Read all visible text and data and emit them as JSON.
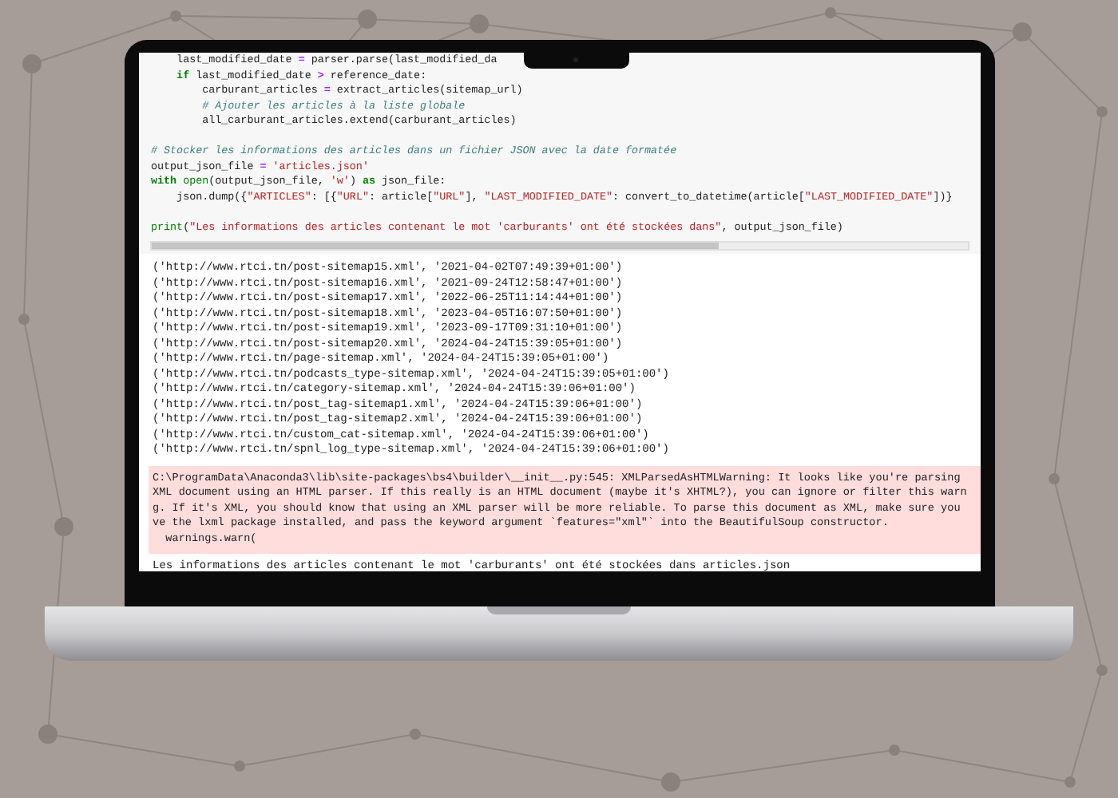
{
  "code_blocks": [
    [
      [
        {
          "kind": "plain",
          "text": "    last_modified_date "
        },
        {
          "kind": "operator",
          "text": "="
        },
        {
          "kind": "plain",
          "text": " parser.parse(last_modified_da"
        }
      ],
      [
        {
          "kind": "keyword",
          "text": "    if"
        },
        {
          "kind": "plain",
          "text": " last_modified_date "
        },
        {
          "kind": "operator",
          "text": ">"
        },
        {
          "kind": "plain",
          "text": " reference_date:"
        }
      ],
      [
        {
          "kind": "plain",
          "text": "        carburant_articles "
        },
        {
          "kind": "operator",
          "text": "="
        },
        {
          "kind": "plain",
          "text": " extract_articles(sitemap_url)"
        }
      ],
      [
        {
          "kind": "comment",
          "text": "        # Ajouter les articles à la liste globale"
        }
      ],
      [
        {
          "kind": "plain",
          "text": "        all_carburant_articles.extend(carburant_articles)"
        }
      ]
    ],
    [
      [
        {
          "kind": "comment",
          "text": "# Stocker les informations des articles dans un fichier JSON avec la date formatée"
        }
      ],
      [
        {
          "kind": "plain",
          "text": "output_json_file "
        },
        {
          "kind": "operator",
          "text": "="
        },
        {
          "kind": "string",
          "text": " 'articles.json'"
        }
      ],
      [
        {
          "kind": "keyword",
          "text": "with"
        },
        {
          "kind": "builtin",
          "text": " open"
        },
        {
          "kind": "plain",
          "text": "(output_json_file, "
        },
        {
          "kind": "string",
          "text": "'w'"
        },
        {
          "kind": "plain",
          "text": ") "
        },
        {
          "kind": "keyword",
          "text": "as"
        },
        {
          "kind": "plain",
          "text": " json_file:"
        }
      ],
      [
        {
          "kind": "plain",
          "text": "    json.dump({"
        },
        {
          "kind": "string",
          "text": "\"ARTICLES\""
        },
        {
          "kind": "plain",
          "text": ": [{"
        },
        {
          "kind": "string",
          "text": "\"URL\""
        },
        {
          "kind": "plain",
          "text": ": article["
        },
        {
          "kind": "string",
          "text": "\"URL\""
        },
        {
          "kind": "plain",
          "text": "], "
        },
        {
          "kind": "string",
          "text": "\"LAST_MODIFIED_DATE\""
        },
        {
          "kind": "plain",
          "text": ": convert_to_datetime(article["
        },
        {
          "kind": "string",
          "text": "\"LAST_MODIFIED_DATE\""
        },
        {
          "kind": "plain",
          "text": "])}"
        }
      ]
    ],
    [
      [
        {
          "kind": "builtin",
          "text": "print"
        },
        {
          "kind": "plain",
          "text": "("
        },
        {
          "kind": "string",
          "text": "\"Les informations des articles contenant le mot 'carburants' ont été stockées dans\""
        },
        {
          "kind": "plain",
          "text": ", output_json_file)"
        }
      ]
    ]
  ],
  "output_lines": [
    "('http://www.rtci.tn/post-sitemap15.xml', '2021-04-02T07:49:39+01:00')",
    "('http://www.rtci.tn/post-sitemap16.xml', '2021-09-24T12:58:47+01:00')",
    "('http://www.rtci.tn/post-sitemap17.xml', '2022-06-25T11:14:44+01:00')",
    "('http://www.rtci.tn/post-sitemap18.xml', '2023-04-05T16:07:50+01:00')",
    "('http://www.rtci.tn/post-sitemap19.xml', '2023-09-17T09:31:10+01:00')",
    "('http://www.rtci.tn/post-sitemap20.xml', '2024-04-24T15:39:05+01:00')",
    "('http://www.rtci.tn/page-sitemap.xml', '2024-04-24T15:39:05+01:00')",
    "('http://www.rtci.tn/podcasts_type-sitemap.xml', '2024-04-24T15:39:05+01:00')",
    "('http://www.rtci.tn/category-sitemap.xml', '2024-04-24T15:39:06+01:00')",
    "('http://www.rtci.tn/post_tag-sitemap1.xml', '2024-04-24T15:39:06+01:00')",
    "('http://www.rtci.tn/post_tag-sitemap2.xml', '2024-04-24T15:39:06+01:00')",
    "('http://www.rtci.tn/custom_cat-sitemap.xml', '2024-04-24T15:39:06+01:00')",
    "('http://www.rtci.tn/spnl_log_type-sitemap.xml', '2024-04-24T15:39:06+01:00')"
  ],
  "warning_lines": [
    "C:\\ProgramData\\Anaconda3\\lib\\site-packages\\bs4\\builder\\__init__.py:545: XMLParsedAsHTMLWarning: It looks like you're parsing",
    "XML document using an HTML parser. If this really is an HTML document (maybe it's XHTML?), you can ignore or filter this warn",
    "g. If it's XML, you should know that using an XML parser will be more reliable. To parse this document as XML, make sure you",
    "ve the lxml package installed, and pass the keyword argument `features=\"xml\"` into the BeautifulSoup constructor.",
    "  warnings.warn("
  ],
  "result_line": "Les informations des articles contenant le mot 'carburants' ont été stockées dans articles.json"
}
